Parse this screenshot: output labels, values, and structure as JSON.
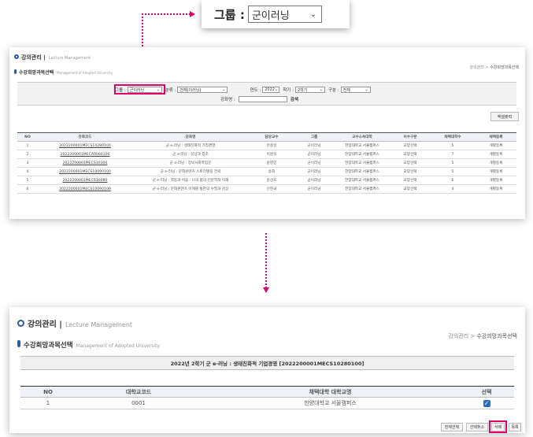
{
  "zoom": {
    "label": "그룹 :",
    "selected": "군이러닝",
    "chevron": "⌄"
  },
  "panel1": {
    "title_ko": "강의관리 |",
    "title_en": "Lecture Management",
    "subtitle_ko": "수강희망과목선택",
    "subtitle_en": "Management of Adopted University",
    "breadcrumb_root": "강의관리 >",
    "breadcrumb_current": "수강희망과목선택",
    "filters": {
      "group_label": "그룹 :",
      "group_value": "군이러닝",
      "field_label": "분류 :",
      "field_value": "전체(이러닝)",
      "year_label": "연도 :",
      "year_value": "2022",
      "term_label": "학기 :",
      "term_value": "2학기",
      "type_label": "구분 :",
      "type_value": "전체",
      "course_label": "강좌명 :",
      "search_label": "검색"
    },
    "excel_button": "엑셀출력",
    "columns": [
      "NO",
      "강좌코드",
      "강좌명",
      "담당교수",
      "그룹",
      "교수소속대학",
      "이수구분",
      "채택대학수",
      "채택등록"
    ],
    "rows": [
      [
        "1",
        "2022200001MECS10280100",
        "군 e-러닝 : 생태친화적 기업경영",
        "안용일",
        "군이러닝",
        "한양대학교 서울캠퍼스",
        "교양선택",
        "5",
        "개별등록"
      ],
      [
        "2",
        "2022200001MECA0060100",
        "군 e-러닝 : 상상과 창조",
        "이원욱",
        "군이러닝",
        "한양대학교 서울캠퍼스",
        "교양선택",
        "7",
        "개별등록"
      ],
      [
        "3",
        "2022200001MECS10300",
        "군 e-러닝 : 정보사회학입문",
        "윤영민",
        "군이러닝",
        "한양대학교 서울캠퍼스",
        "교양선택",
        "5",
        "개별등록"
      ],
      [
        "4",
        "2022200001MECS10090100",
        "군 e-러닝 : 문화콘텐츠 스토리텔링 전략",
        "송희",
        "군이러닝",
        "한양대학교 서울캠퍼스",
        "교양선택",
        "5",
        "개별등록"
      ],
      [
        "5",
        "2022200001MECS10080",
        "군 e-러닝 : 역동과 비움 : 나의 몸의 인문학적 이해",
        "윤상호",
        "군이러닝",
        "한양대학교 서울캠퍼스",
        "교양선택",
        "6",
        "개별등록"
      ],
      [
        "6",
        "2022200001MECS10090100",
        "군 e-러닝 : 문화콘텐츠 이해를 통한의 수필과 감상",
        "신현국",
        "군이러닝",
        "한양대학교 서울캠퍼스",
        "교양선택",
        "4",
        "개별등록"
      ]
    ]
  },
  "panel2": {
    "title_ko": "강의관리 |",
    "title_en": "Lecture Management",
    "subtitle_ko": "수강희망과목선택",
    "subtitle_en": "Management of Adopted University",
    "breadcrumb_root": "강의관리 >",
    "breadcrumb_current": "수강희망과목선택",
    "course_heading": "2022년 2학기 군 e-러닝 : 생태친화적 기업경영 [2022200001MECS10280100]",
    "columns": [
      "NO",
      "대학교코드",
      "채택대학 대학교명",
      "선택"
    ],
    "rows": [
      [
        "1",
        "0001",
        "한양대학교 서울캠퍼스"
      ]
    ],
    "buttons": {
      "select_all": "전체선택",
      "deselect_all": "선택취소",
      "delete": "삭제",
      "list": "목록"
    },
    "check_glyph": "✓"
  },
  "colors": {
    "accent": "#e0006a",
    "brand_blue": "#2f5d9b",
    "checkbox": "#2a6cc4"
  }
}
